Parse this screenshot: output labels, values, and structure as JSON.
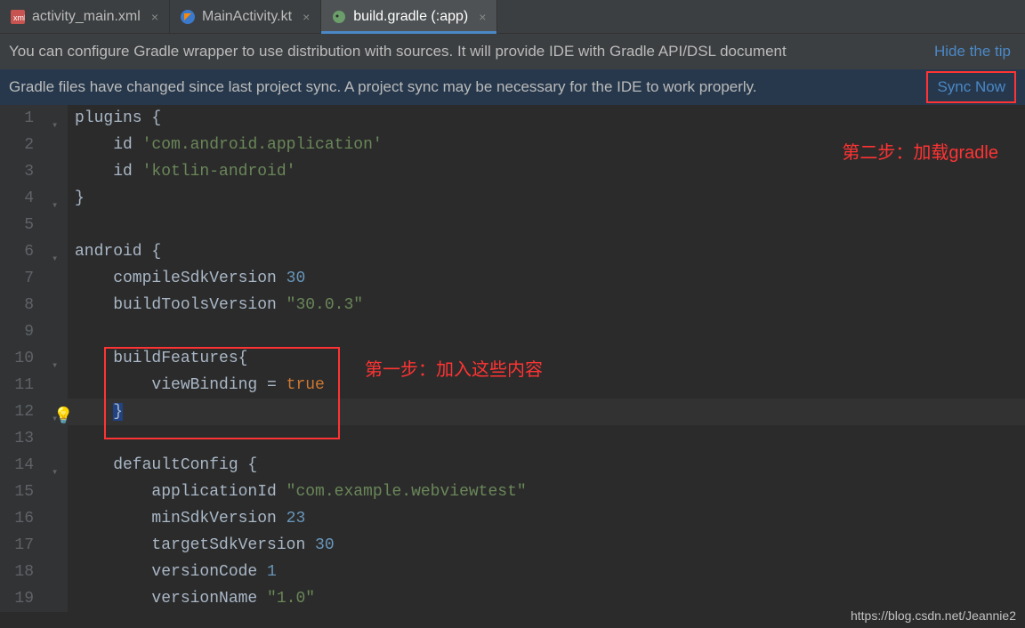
{
  "tabs": [
    {
      "label": "activity_main.xml",
      "icon": "xml"
    },
    {
      "label": "MainActivity.kt",
      "icon": "kotlin"
    },
    {
      "label": "build.gradle (:app)",
      "icon": "elephant",
      "active": true
    }
  ],
  "notifications": {
    "wrapper": {
      "text": "You can configure Gradle wrapper to use distribution with sources. It will provide IDE with Gradle API/DSL document",
      "hide": "Hide the tip"
    },
    "sync": {
      "text": "Gradle files have changed since last project sync. A project sync may be necessary for the IDE to work properly.",
      "action": "Sync Now"
    }
  },
  "annotations": {
    "step1": "第一步：加入这些内容",
    "step2": "第二步：加载gradle"
  },
  "watermark": "https://blog.csdn.net/Jeannie2",
  "code": {
    "lines": [
      {
        "n": 1,
        "html": "plugins {"
      },
      {
        "n": 2,
        "html": "    id <span class='str'>'com.android.application'</span>"
      },
      {
        "n": 3,
        "html": "    id <span class='str'>'kotlin-android'</span>"
      },
      {
        "n": 4,
        "html": "}"
      },
      {
        "n": 5,
        "html": ""
      },
      {
        "n": 6,
        "html": "android {"
      },
      {
        "n": 7,
        "html": "    compileSdkVersion <span class='num'>30</span>"
      },
      {
        "n": 8,
        "html": "    buildToolsVersion <span class='str'>\"30.0.3\"</span>"
      },
      {
        "n": 9,
        "html": ""
      },
      {
        "n": 10,
        "html": "    buildFeatures{"
      },
      {
        "n": 11,
        "html": "        viewBinding = <span class='kw'>true</span>"
      },
      {
        "n": 12,
        "html": "    <span style='background:#214283'>}</span>"
      },
      {
        "n": 13,
        "html": ""
      },
      {
        "n": 14,
        "html": "    defaultConfig {"
      },
      {
        "n": 15,
        "html": "        applicationId <span class='str'>\"com.example.webviewtest\"</span>"
      },
      {
        "n": 16,
        "html": "        minSdkVersion <span class='num'>23</span>"
      },
      {
        "n": 17,
        "html": "        targetSdkVersion <span class='num'>30</span>"
      },
      {
        "n": 18,
        "html": "        versionCode <span class='num'>1</span>"
      },
      {
        "n": 19,
        "html": "        versionName <span class='str'>\"1.0\"</span>"
      }
    ]
  }
}
